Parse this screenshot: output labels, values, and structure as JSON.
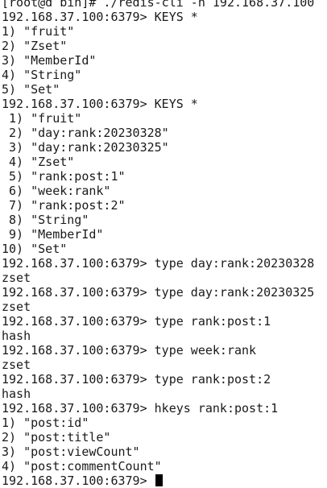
{
  "terminal": {
    "lines": [
      "[root@d bin]# ./redis-cli -h 192.168.37.100",
      "192.168.37.100:6379> KEYS *",
      "1) \"fruit\"",
      "2) \"Zset\"",
      "3) \"MemberId\"",
      "4) \"String\"",
      "5) \"Set\"",
      "192.168.37.100:6379> KEYS *",
      " 1) \"fruit\"",
      " 2) \"day:rank:20230328\"",
      " 3) \"day:rank:20230325\"",
      " 4) \"Zset\"",
      " 5) \"rank:post:1\"",
      " 6) \"week:rank\"",
      " 7) \"rank:post:2\"",
      " 8) \"String\"",
      " 9) \"MemberId\"",
      "10) \"Set\"",
      "192.168.37.100:6379> type day:rank:20230328",
      "zset",
      "192.168.37.100:6379> type day:rank:20230325",
      "zset",
      "192.168.37.100:6379> type rank:post:1",
      "hash",
      "192.168.37.100:6379> type week:rank",
      "zset",
      "192.168.37.100:6379> type rank:post:2",
      "hash",
      "192.168.37.100:6379> hkeys rank:post:1",
      "1) \"post:id\"",
      "2) \"post:title\"",
      "3) \"post:viewCount\"",
      "4) \"post:commentCount\""
    ],
    "prompt": "192.168.37.100:6379> ",
    "colors": {
      "background": "#ffffff",
      "text": "#1a1a1a",
      "cursor": "#000000"
    }
  }
}
